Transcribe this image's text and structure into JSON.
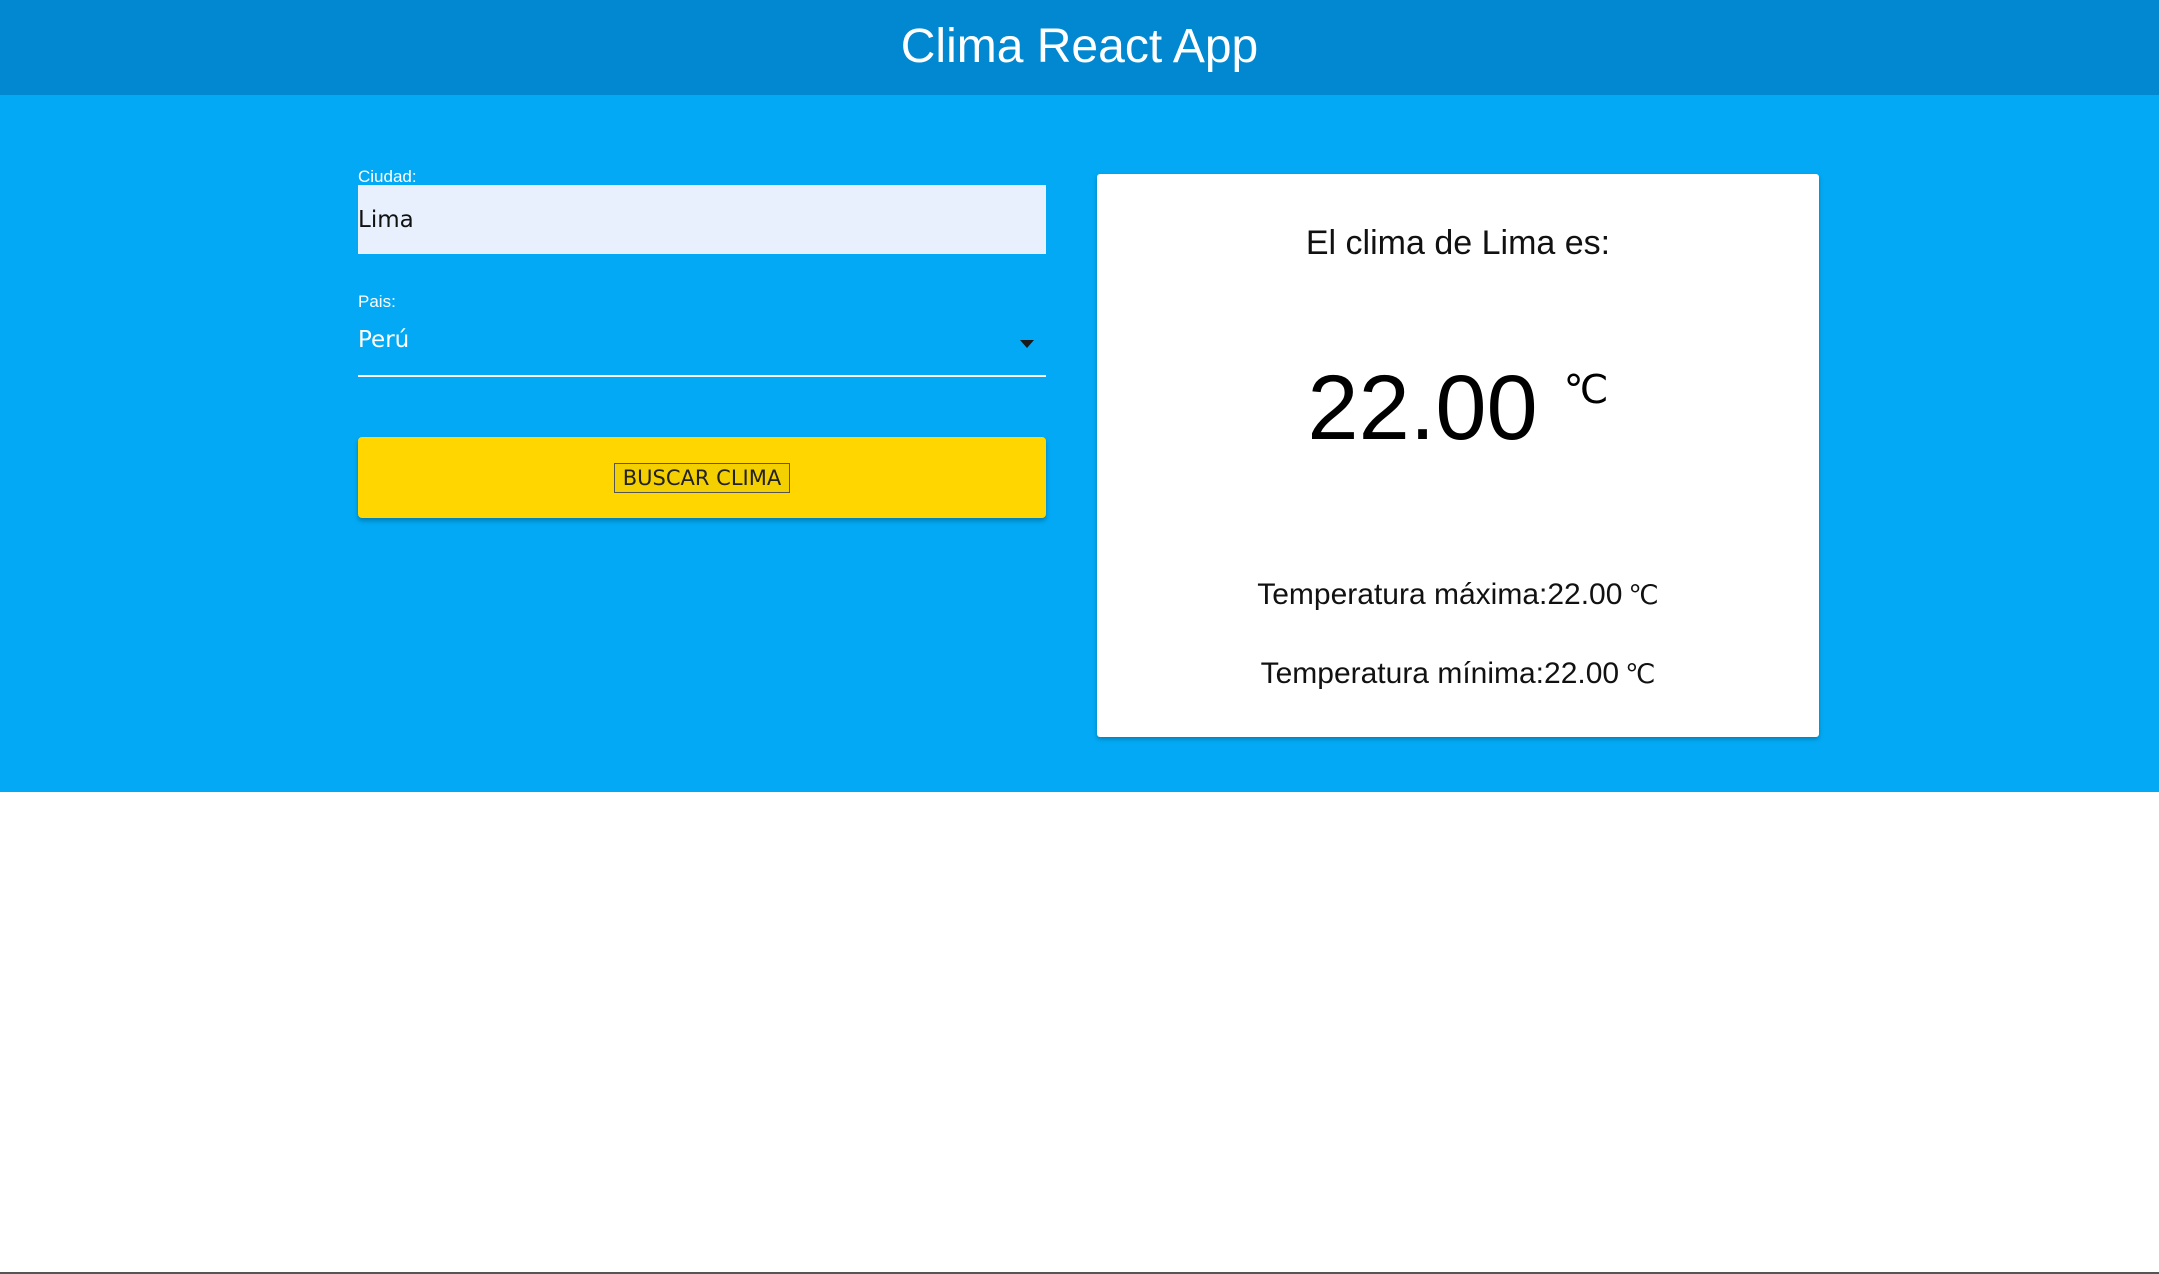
{
  "header": {
    "title": "Clima React App"
  },
  "form": {
    "city_label": "Ciudad:",
    "city_value": "Lima",
    "country_label": "Pais:",
    "country_value": "Perú",
    "submit_label": "BUSCAR CLIMA"
  },
  "weather": {
    "title": "El clima de Lima es:",
    "temperature": "22.00",
    "unit": "℃",
    "max_label": "Temperatura máxima:22.00",
    "min_label": "Temperatura mínima:22.00"
  },
  "colors": {
    "header_bg": "#0288d1",
    "main_bg": "#03a9f4",
    "button_bg": "#ffd600",
    "input_bg": "#e8f0fe"
  },
  "icons": {
    "country_dropdown": "caret-down-icon"
  }
}
